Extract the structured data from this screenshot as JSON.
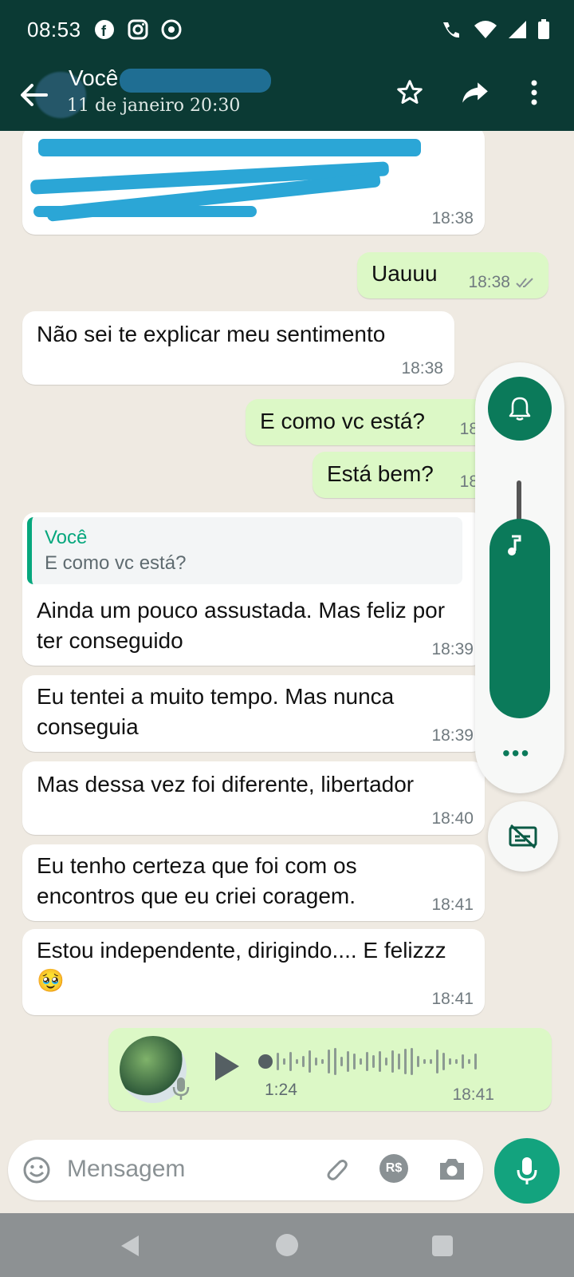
{
  "status": {
    "time": "08:53"
  },
  "header": {
    "title": "Você",
    "subtitle": "11 de janeiro 20:30"
  },
  "messages": {
    "m1_time": "18:38",
    "m2_text": "Uauuu",
    "m2_time": "18:38",
    "m3_text": "Não sei te explicar meu sentimento",
    "m3_time": "18:38",
    "m4_text": "E como vc está?",
    "m4_time": "18",
    "m5_text": "Está bem?",
    "m5_time": "18",
    "m6_quote_author": "Você",
    "m6_quote_text": "E como vc está?",
    "m6_text": "Ainda um pouco assustada. Mas feliz por ter conseguido",
    "m6_time": "18:39",
    "m7_text": "Eu tentei a muito tempo. Mas nunca conseguia",
    "m7_time": "18:39",
    "m8_text": "Mas dessa vez foi diferente, libertador",
    "m8_time": "18:40",
    "m9_text": "Eu tenho certeza que foi com os encontros que eu criei coragem.",
    "m9_time": "18:41",
    "m10_text": "Estou independente, dirigindo.... E felizzz 🥹",
    "m10_time": "18:41",
    "audio_duration": "1:24",
    "audio_time": "18:41"
  },
  "composer": {
    "placeholder": "Mensagem",
    "payment_badge": "R$"
  },
  "side_panel": {
    "more": "•••"
  },
  "colors": {
    "header": "#0b3a34",
    "accent": "#0b7a5a",
    "outgoing": "#dcf8c6"
  }
}
